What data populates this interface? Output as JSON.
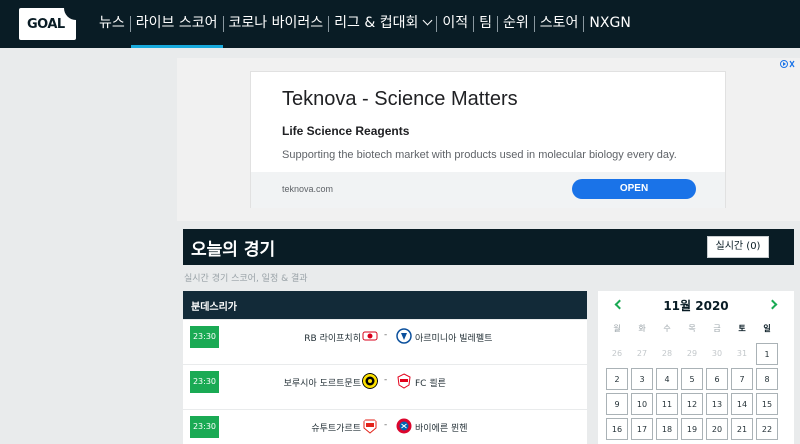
{
  "logo": {
    "text": "GOAL"
  },
  "nav": {
    "items": [
      {
        "label": "뉴스",
        "active": false
      },
      {
        "label": "라이브 스코어",
        "active": true
      },
      {
        "label": "코로나 바이러스",
        "active": false
      },
      {
        "label": "리그 & 컵대회",
        "active": false,
        "dropdown": true
      },
      {
        "label": "이적",
        "active": false
      },
      {
        "label": "팀",
        "active": false
      },
      {
        "label": "순위",
        "active": false
      },
      {
        "label": "스토어",
        "active": false
      },
      {
        "label": "NXGN",
        "active": false
      }
    ]
  },
  "ad": {
    "title": "Teknova - Science Matters",
    "subtitle": "Life Science Reagents",
    "description": "Supporting the biotech market with products used in molecular biology every day.",
    "url": "teknova.com",
    "cta": "OPEN"
  },
  "today": {
    "title": "오늘의 경기",
    "live_button": "실시간 (0)",
    "subtitle": "실시간 경기 스코어, 일정 & 결과"
  },
  "league": {
    "name": "분데스리가"
  },
  "matches": [
    {
      "time": "23:30",
      "home": "RB 라이프치히",
      "away": "아르미니아 빌레펠트",
      "home_color": "#d8001b",
      "away_color": "#0a4f9c"
    },
    {
      "time": "23:30",
      "home": "보루시아 도르트문트",
      "away": "FC 쾰른",
      "home_color": "#fde100",
      "away_color": "#e3001b"
    },
    {
      "time": "23:30",
      "home": "슈투트가르트",
      "away": "바이에른 뮌헨",
      "home_color": "#e32219",
      "away_color": "#0066b2"
    }
  ],
  "calendar": {
    "title": "11월 2020",
    "weekdays": [
      "월",
      "화",
      "수",
      "목",
      "금",
      "토",
      "일"
    ],
    "rows": [
      [
        "26",
        "27",
        "28",
        "29",
        "30",
        "31",
        "1"
      ],
      [
        "2",
        "3",
        "4",
        "5",
        "6",
        "7",
        "8"
      ],
      [
        "9",
        "10",
        "11",
        "12",
        "13",
        "14",
        "15"
      ],
      [
        "16",
        "17",
        "18",
        "19",
        "20",
        "21",
        "22"
      ]
    ]
  },
  "colors": {
    "nav_bg": "#091c25",
    "accent": "#18aadc",
    "live_green": "#1aaa54",
    "ad_blue": "#1a73e8"
  }
}
